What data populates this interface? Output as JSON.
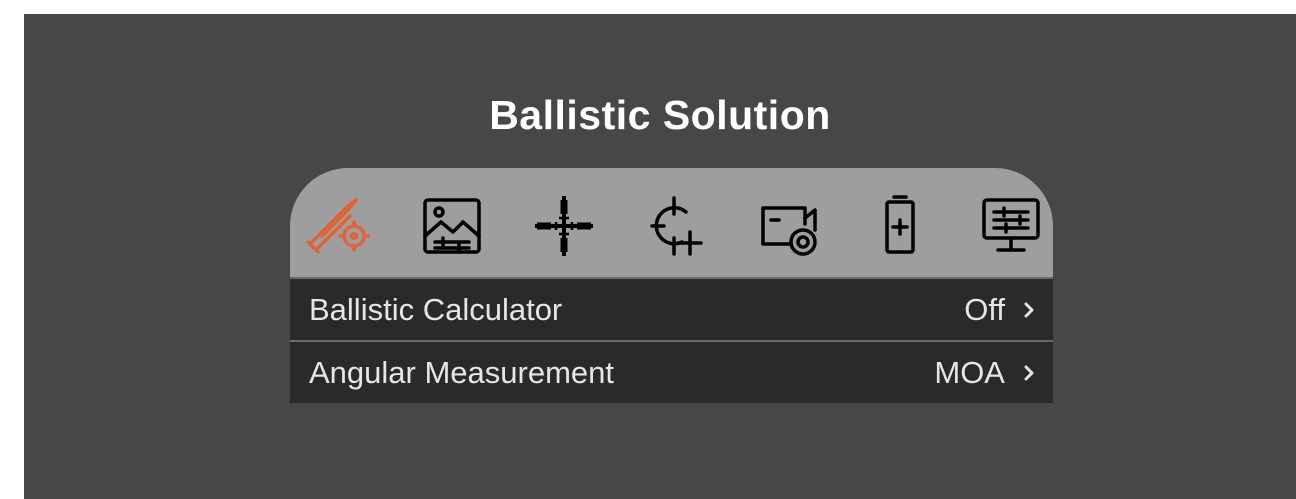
{
  "title": "Ballistic Solution",
  "accent_color": "#e0643a",
  "tabs": [
    {
      "icon": "bullet-target-icon",
      "active": true
    },
    {
      "icon": "image-adjust-icon",
      "active": false
    },
    {
      "icon": "reticle-icon",
      "active": false
    },
    {
      "icon": "crosshair-plus-icon",
      "active": false
    },
    {
      "icon": "record-video-icon",
      "active": false
    },
    {
      "icon": "battery-icon",
      "active": false
    },
    {
      "icon": "display-settings-icon",
      "active": false
    }
  ],
  "rows": [
    {
      "label": "Ballistic Calculator",
      "value": "Off"
    },
    {
      "label": "Angular Measurement",
      "value": "MOA"
    }
  ]
}
